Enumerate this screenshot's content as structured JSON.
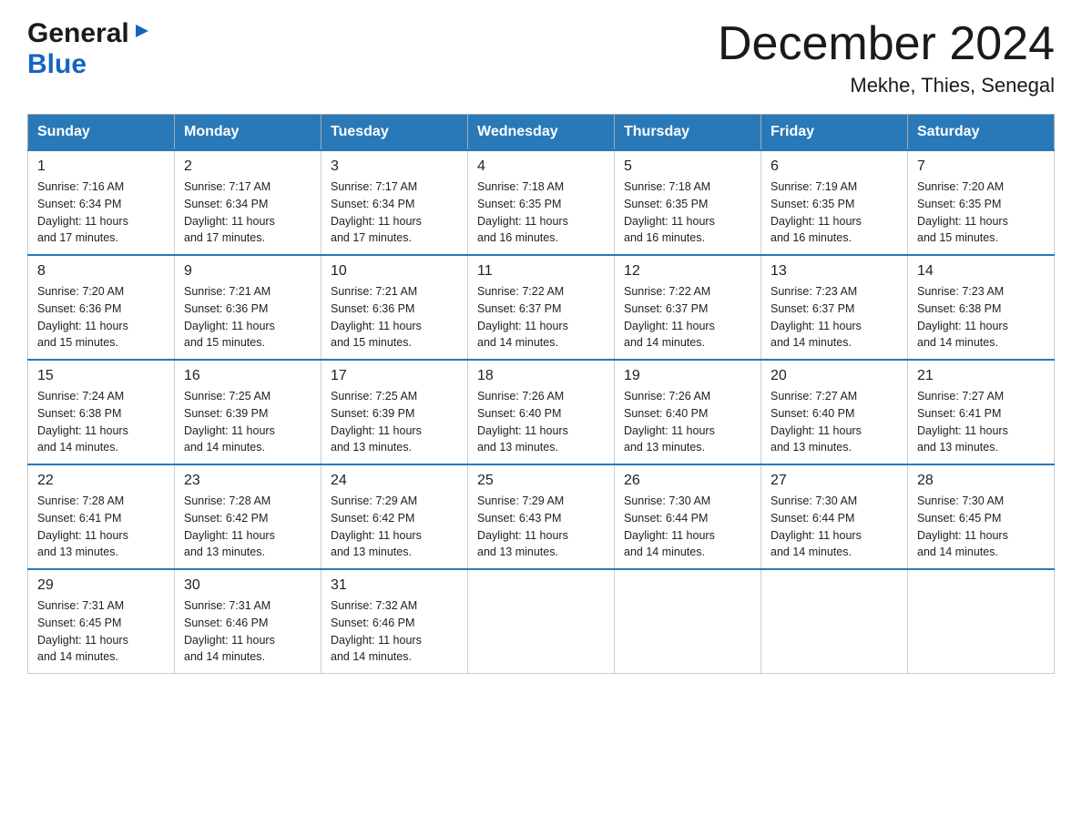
{
  "logo": {
    "general": "General",
    "blue": "Blue",
    "arrow": "▶"
  },
  "title": "December 2024",
  "subtitle": "Mekhe, Thies, Senegal",
  "days_of_week": [
    "Sunday",
    "Monday",
    "Tuesday",
    "Wednesday",
    "Thursday",
    "Friday",
    "Saturday"
  ],
  "weeks": [
    [
      {
        "day": "1",
        "sunrise": "7:16 AM",
        "sunset": "6:34 PM",
        "daylight": "11 hours and 17 minutes."
      },
      {
        "day": "2",
        "sunrise": "7:17 AM",
        "sunset": "6:34 PM",
        "daylight": "11 hours and 17 minutes."
      },
      {
        "day": "3",
        "sunrise": "7:17 AM",
        "sunset": "6:34 PM",
        "daylight": "11 hours and 17 minutes."
      },
      {
        "day": "4",
        "sunrise": "7:18 AM",
        "sunset": "6:35 PM",
        "daylight": "11 hours and 16 minutes."
      },
      {
        "day": "5",
        "sunrise": "7:18 AM",
        "sunset": "6:35 PM",
        "daylight": "11 hours and 16 minutes."
      },
      {
        "day": "6",
        "sunrise": "7:19 AM",
        "sunset": "6:35 PM",
        "daylight": "11 hours and 16 minutes."
      },
      {
        "day": "7",
        "sunrise": "7:20 AM",
        "sunset": "6:35 PM",
        "daylight": "11 hours and 15 minutes."
      }
    ],
    [
      {
        "day": "8",
        "sunrise": "7:20 AM",
        "sunset": "6:36 PM",
        "daylight": "11 hours and 15 minutes."
      },
      {
        "day": "9",
        "sunrise": "7:21 AM",
        "sunset": "6:36 PM",
        "daylight": "11 hours and 15 minutes."
      },
      {
        "day": "10",
        "sunrise": "7:21 AM",
        "sunset": "6:36 PM",
        "daylight": "11 hours and 15 minutes."
      },
      {
        "day": "11",
        "sunrise": "7:22 AM",
        "sunset": "6:37 PM",
        "daylight": "11 hours and 14 minutes."
      },
      {
        "day": "12",
        "sunrise": "7:22 AM",
        "sunset": "6:37 PM",
        "daylight": "11 hours and 14 minutes."
      },
      {
        "day": "13",
        "sunrise": "7:23 AM",
        "sunset": "6:37 PM",
        "daylight": "11 hours and 14 minutes."
      },
      {
        "day": "14",
        "sunrise": "7:23 AM",
        "sunset": "6:38 PM",
        "daylight": "11 hours and 14 minutes."
      }
    ],
    [
      {
        "day": "15",
        "sunrise": "7:24 AM",
        "sunset": "6:38 PM",
        "daylight": "11 hours and 14 minutes."
      },
      {
        "day": "16",
        "sunrise": "7:25 AM",
        "sunset": "6:39 PM",
        "daylight": "11 hours and 14 minutes."
      },
      {
        "day": "17",
        "sunrise": "7:25 AM",
        "sunset": "6:39 PM",
        "daylight": "11 hours and 13 minutes."
      },
      {
        "day": "18",
        "sunrise": "7:26 AM",
        "sunset": "6:40 PM",
        "daylight": "11 hours and 13 minutes."
      },
      {
        "day": "19",
        "sunrise": "7:26 AM",
        "sunset": "6:40 PM",
        "daylight": "11 hours and 13 minutes."
      },
      {
        "day": "20",
        "sunrise": "7:27 AM",
        "sunset": "6:40 PM",
        "daylight": "11 hours and 13 minutes."
      },
      {
        "day": "21",
        "sunrise": "7:27 AM",
        "sunset": "6:41 PM",
        "daylight": "11 hours and 13 minutes."
      }
    ],
    [
      {
        "day": "22",
        "sunrise": "7:28 AM",
        "sunset": "6:41 PM",
        "daylight": "11 hours and 13 minutes."
      },
      {
        "day": "23",
        "sunrise": "7:28 AM",
        "sunset": "6:42 PM",
        "daylight": "11 hours and 13 minutes."
      },
      {
        "day": "24",
        "sunrise": "7:29 AM",
        "sunset": "6:42 PM",
        "daylight": "11 hours and 13 minutes."
      },
      {
        "day": "25",
        "sunrise": "7:29 AM",
        "sunset": "6:43 PM",
        "daylight": "11 hours and 13 minutes."
      },
      {
        "day": "26",
        "sunrise": "7:30 AM",
        "sunset": "6:44 PM",
        "daylight": "11 hours and 14 minutes."
      },
      {
        "day": "27",
        "sunrise": "7:30 AM",
        "sunset": "6:44 PM",
        "daylight": "11 hours and 14 minutes."
      },
      {
        "day": "28",
        "sunrise": "7:30 AM",
        "sunset": "6:45 PM",
        "daylight": "11 hours and 14 minutes."
      }
    ],
    [
      {
        "day": "29",
        "sunrise": "7:31 AM",
        "sunset": "6:45 PM",
        "daylight": "11 hours and 14 minutes."
      },
      {
        "day": "30",
        "sunrise": "7:31 AM",
        "sunset": "6:46 PM",
        "daylight": "11 hours and 14 minutes."
      },
      {
        "day": "31",
        "sunrise": "7:32 AM",
        "sunset": "6:46 PM",
        "daylight": "11 hours and 14 minutes."
      },
      null,
      null,
      null,
      null
    ]
  ],
  "labels": {
    "sunrise": "Sunrise:",
    "sunset": "Sunset:",
    "daylight": "Daylight:"
  }
}
